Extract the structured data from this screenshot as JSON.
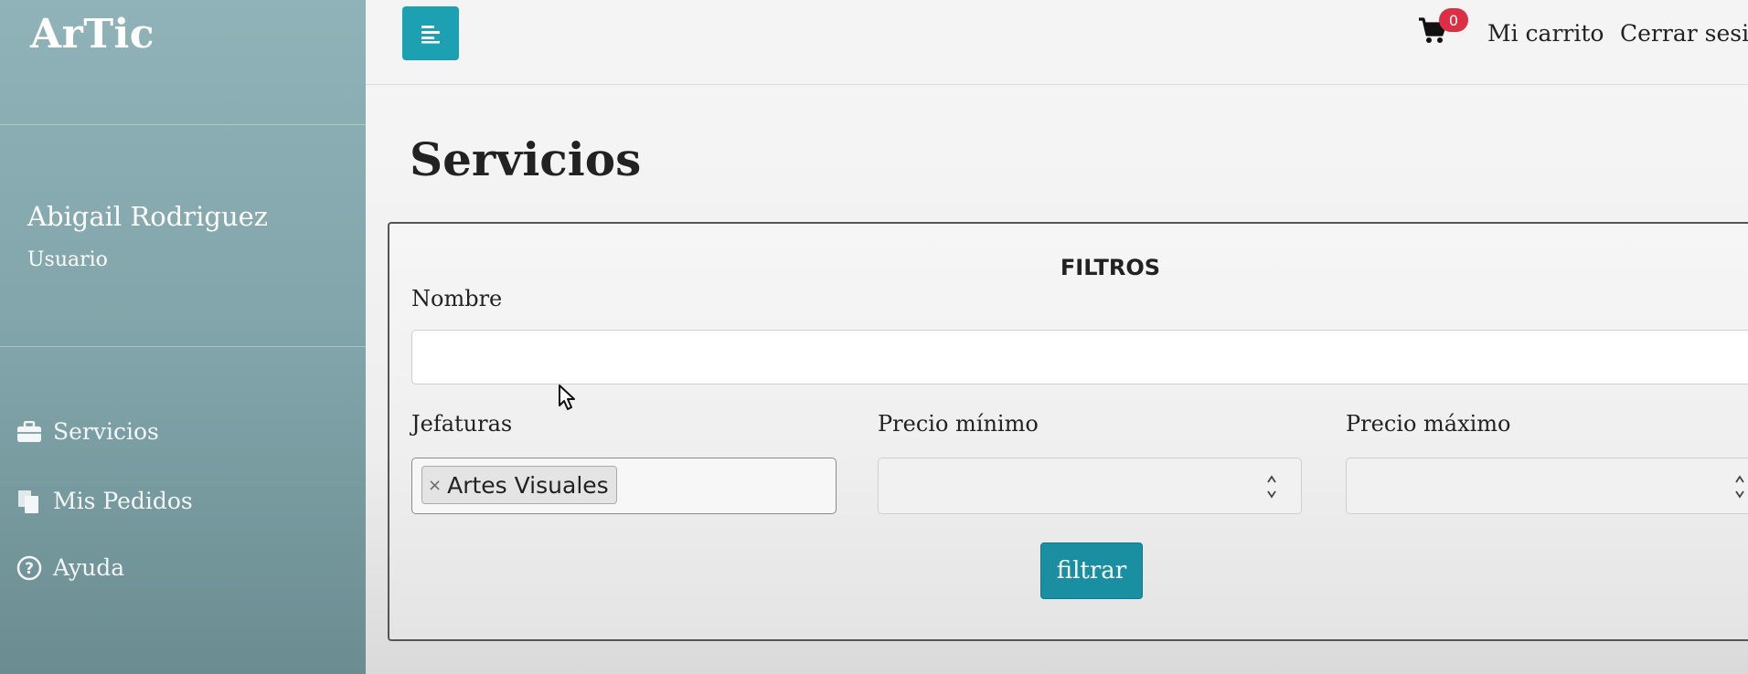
{
  "app": {
    "brand": "ArTic"
  },
  "user": {
    "name": "Abigail Rodriguez",
    "role": "Usuario"
  },
  "sidebar": {
    "items": [
      {
        "label": "Servicios",
        "icon": "briefcase-icon"
      },
      {
        "label": "Mis Pedidos",
        "icon": "documents-icon"
      },
      {
        "label": "Ayuda",
        "icon": "question-circle-icon"
      }
    ]
  },
  "topbar": {
    "cart_count": "0",
    "cart_label": "Mi carrito",
    "logout_label": "Cerrar sesió"
  },
  "main": {
    "title": "Servicios",
    "filters": {
      "heading": "FILTROS",
      "name_label": "Nombre",
      "name_value": "",
      "department_label": "Jefaturas",
      "department_selected": "Artes Visuales",
      "min_price_label": "Precio mínimo",
      "min_price_value": "",
      "max_price_label": "Precio máximo",
      "max_price_value": "",
      "submit_label": "filtrar"
    }
  },
  "colors": {
    "sidebar_bg": "#8fb3b8",
    "accent": "#1ea0b3",
    "button": "#1a8fa2",
    "badge": "#dc2f45"
  }
}
